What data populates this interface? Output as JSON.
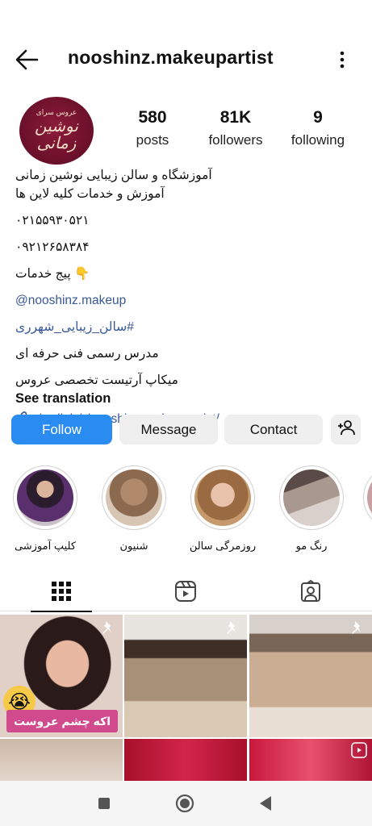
{
  "header": {
    "username": "nooshinz.makeupartist"
  },
  "avatar": {
    "small_text": "عروس سرای",
    "main_text": "نوشین زمانی"
  },
  "stats": {
    "posts": {
      "value": "580",
      "label": "posts"
    },
    "followers": {
      "value": "81K",
      "label": "followers"
    },
    "following": {
      "value": "9",
      "label": "following"
    }
  },
  "bio": {
    "line1": "آموزشگاه و سالن زیبایی نوشین زمانی",
    "line2": "آموزش و خدمات کلیه لاین ها",
    "phone1": "۰۲۱۵۵۹۳۰۵۲۱",
    "phone2": "۰۹۲۱۲۶۵۸۳۸۴",
    "services": "👇 پیج خدمات",
    "mention": "@nooshinz.makeup",
    "hashtag": "#سالن_زیبایی_شهرری",
    "line7": "مدرس رسمی فنی حرفه ای",
    "line8": "میکاپ آرتیست  تخصصی عروس",
    "see_translation": "See translation",
    "link": "vira-link.ir/nooshinz-makeupartist/"
  },
  "actions": {
    "follow": "Follow",
    "message": "Message",
    "contact": "Contact"
  },
  "highlights": [
    {
      "label": "کلیپ آموزشی"
    },
    {
      "label": "شنیون"
    },
    {
      "label": "روزمرگی سالن"
    },
    {
      "label": "رنگ مو"
    }
  ],
  "posts": {
    "first_overlay": "اکه چشم عروست"
  },
  "colors": {
    "follow_button": "#2a8cf0",
    "link": "#385898",
    "avatar_bg": "#6e1230"
  },
  "icons": {
    "back": "arrow-left-icon",
    "more": "kebab-icon",
    "add_user": "add-user-icon",
    "grid": "grid-icon",
    "reels": "reels-icon",
    "tagged": "tagged-icon",
    "pin": "pin-icon",
    "nav_recents": "square-icon",
    "nav_home": "circle-icon",
    "nav_back": "triangle-icon"
  }
}
